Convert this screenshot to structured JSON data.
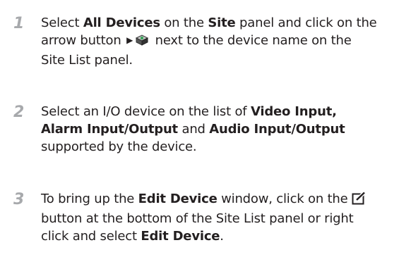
{
  "steps": [
    {
      "number": "1",
      "line1": {
        "t1": "Select ",
        "b1": "All Devices",
        "t2": " on the ",
        "b2": "Site",
        "t3": " panel and click on the"
      },
      "line2": {
        "t1": "arrow button",
        "t2": "next to the device name on the"
      },
      "line3": {
        "t1": "Site List panel."
      },
      "icons": {
        "arrow": "play-arrow-icon",
        "device": "camera-device-icon"
      }
    },
    {
      "number": "2",
      "line1": {
        "t1": "Select an I/O device on the list of ",
        "b1": "Video Input,"
      },
      "line2": {
        "b1": "Alarm Input/Output",
        "t1": " and ",
        "b2": "Audio Input/Output"
      },
      "line3": {
        "t1": "supported by the device."
      }
    },
    {
      "number": "3",
      "line1": {
        "t1": "To bring up the ",
        "b1": "Edit Device",
        "t2": " window, click on the"
      },
      "line2": {
        "t1": "button at the bottom of the Site List panel or right"
      },
      "line3": {
        "t1": "click and select ",
        "b1": "Edit Device",
        "t2": "."
      },
      "icons": {
        "edit": "edit-pencil-icon"
      }
    }
  ]
}
